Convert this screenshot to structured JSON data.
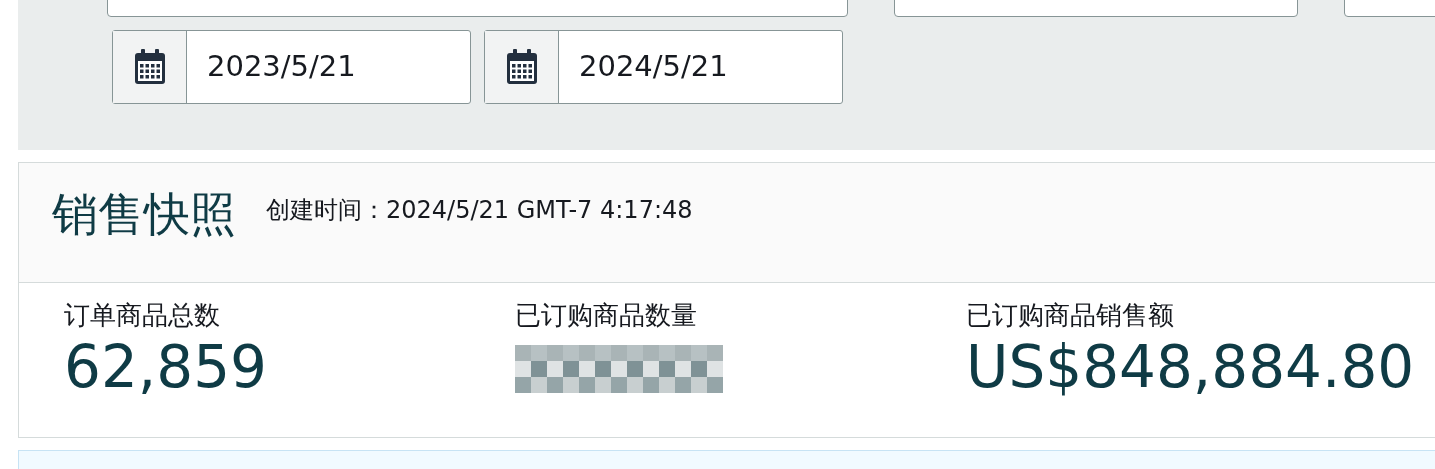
{
  "filters": {
    "top_fields": [
      {
        "kind": "field"
      },
      {
        "kind": "field"
      },
      {
        "kind": "field"
      }
    ],
    "date_range": [
      {
        "value": "2023/5/21"
      },
      {
        "value": "2024/5/21"
      }
    ]
  },
  "snapshot": {
    "title": "销售快照",
    "created": "创建时间：2024/5/21 GMT-7 4:17:48",
    "metrics": [
      {
        "label": "订单商品总数",
        "value": "62,859",
        "redacted": false
      },
      {
        "label": "已订购商品数量",
        "redacted": true
      },
      {
        "label": "已订购商品销售额",
        "value": "US$848,884.80",
        "redacted": false
      }
    ]
  },
  "notice": {
    "kind": "info"
  }
}
